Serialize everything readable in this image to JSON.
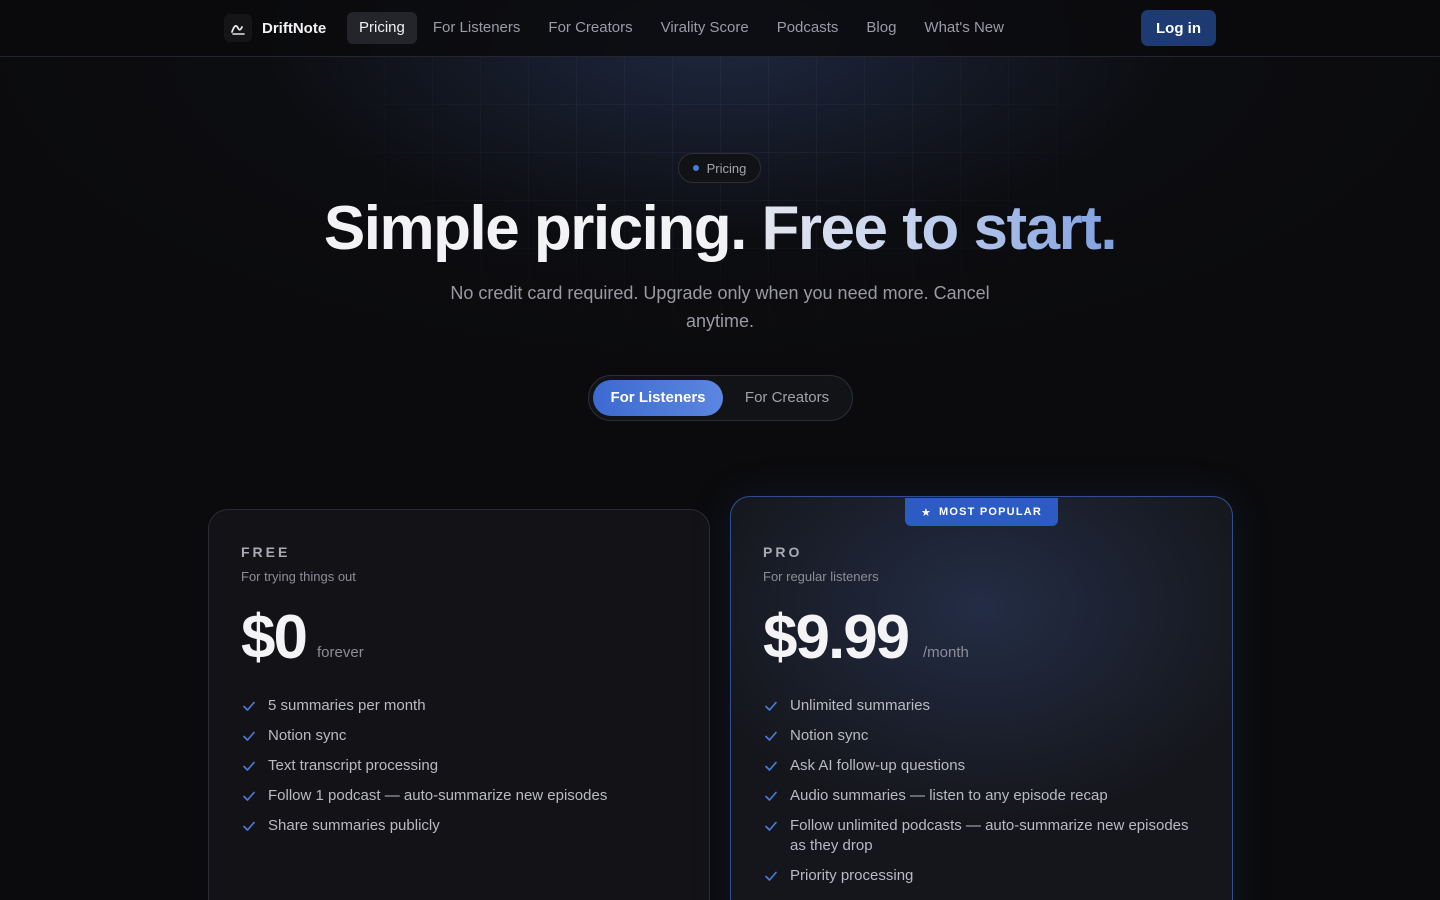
{
  "nav": {
    "brand": "DriftNote",
    "links": [
      "Pricing",
      "For Listeners",
      "For Creators",
      "Virality Score",
      "Podcasts",
      "Blog",
      "What's New"
    ],
    "active_link": "Pricing",
    "login_label": "Log in"
  },
  "hero": {
    "badge": "Pricing",
    "headline_part1": "Simple pricing.",
    "headline_part2": "Free to start.",
    "subhead": "No credit card required. Upgrade only when you need more. Cancel anytime.",
    "toggle": {
      "selected": "For Listeners",
      "other": "For Creators"
    }
  },
  "plans": [
    {
      "name": "FREE",
      "description": "For trying things out",
      "price": "$0",
      "period": "forever",
      "features": [
        "5 summaries per month",
        "Notion sync",
        "Text transcript processing",
        "Follow 1 podcast — auto-summarize new episodes",
        "Share summaries publicly"
      ]
    },
    {
      "name": "PRO",
      "badge": "MOST POPULAR",
      "description": "For regular listeners",
      "price": "$9.99",
      "period": "/month",
      "features": [
        "Unlimited summaries",
        "Notion sync",
        "Ask AI follow-up questions",
        "Audio summaries — listen to any episode recap",
        "Follow unlimited podcasts — auto-summarize new episodes as they drop",
        "Priority processing"
      ]
    }
  ],
  "colors": {
    "accent": "#3d6ad0",
    "login_bg": "#1d3a72",
    "check": "#4a7ad8"
  }
}
